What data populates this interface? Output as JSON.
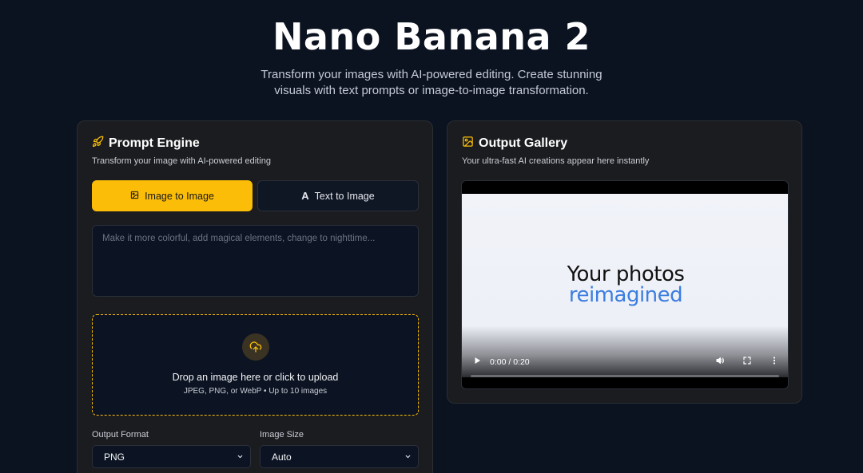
{
  "hero": {
    "title": "Nano Banana 2",
    "subtitle": "Transform your images with AI-powered editing. Create stunning visuals with text prompts or image-to-image transformation."
  },
  "prompt_engine": {
    "title": "Prompt Engine",
    "title_icon": "rocket-icon",
    "subtitle": "Transform your image with AI-powered editing",
    "tabs": [
      {
        "label": "Image to Image",
        "icon": "image-icon",
        "active": true
      },
      {
        "label": "Text to Image",
        "icon": "text-a-icon",
        "glyph": "A",
        "active": false
      }
    ],
    "prompt_placeholder": "Make it more colorful, add magical elements, change to nighttime...",
    "upload": {
      "icon": "cloud-upload-icon",
      "title": "Drop an image here or click to upload",
      "subtitle": "JPEG, PNG, or WebP • Up to 10 images"
    },
    "output_format": {
      "label": "Output Format",
      "value": "PNG"
    },
    "image_size": {
      "label": "Image Size",
      "value": "Auto"
    }
  },
  "output_gallery": {
    "title": "Output Gallery",
    "title_icon": "image-icon",
    "subtitle": "Your ultra-fast AI creations appear here instantly",
    "video": {
      "line1": "Your photos",
      "line2": "reimagined",
      "time": "0:00 / 0:20",
      "progress": 0
    }
  },
  "colors": {
    "background": "#0b1220",
    "accent": "#fbbd08",
    "panel": "#1b1c1f",
    "video_text_accent": "#3b7de0"
  }
}
